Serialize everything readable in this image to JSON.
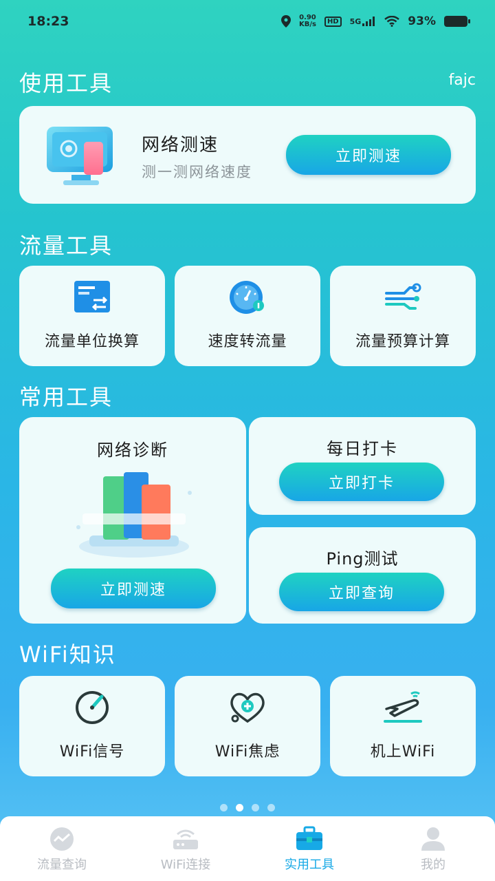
{
  "status": {
    "time": "18:23",
    "speed_top": "0.90",
    "speed_bottom": "KB/s",
    "hd": "HD",
    "signal": "5G",
    "battery": "93%"
  },
  "user_tag": "fajc",
  "sections": {
    "use_tools": "使用工具",
    "traffic_tools": "流量工具",
    "common_tools": "常用工具",
    "wifi_knowledge": "WiFi知识"
  },
  "speed_test_card": {
    "title": "网络测速",
    "subtitle": "测一测网络速度",
    "button": "立即测速"
  },
  "traffic_tools": [
    {
      "label": "流量单位换算",
      "icon": "unit-convert-icon"
    },
    {
      "label": "速度转流量",
      "icon": "speedometer-icon"
    },
    {
      "label": "流量预算计算",
      "icon": "budget-calc-icon"
    }
  ],
  "common_tools": {
    "diagnose": {
      "title": "网络诊断",
      "button": "立即测速"
    },
    "checkin": {
      "title": "每日打卡",
      "button": "立即打卡"
    },
    "ping": {
      "title": "Ping测试",
      "button": "立即查询"
    }
  },
  "wifi_knowledge": [
    {
      "label": "WiFi信号",
      "icon": "signal-gauge-icon"
    },
    {
      "label": "WiFi焦虑",
      "icon": "heart-stethoscope-icon"
    },
    {
      "label": "机上WiFi",
      "icon": "airplane-wifi-icon"
    }
  ],
  "pager": {
    "count": 4,
    "active": 2
  },
  "bottom_nav": [
    {
      "label": "流量查询",
      "icon": "traffic-query-icon",
      "active": false
    },
    {
      "label": "WiFi连接",
      "icon": "router-icon",
      "active": false
    },
    {
      "label": "实用工具",
      "icon": "toolbox-icon",
      "active": true
    },
    {
      "label": "我的",
      "icon": "profile-icon",
      "active": false
    }
  ],
  "colors": {
    "accent": "#17a9e6",
    "card_bg": "#eefbfb",
    "button_start": "#1fd2c2",
    "button_end": "#18a6e6"
  }
}
